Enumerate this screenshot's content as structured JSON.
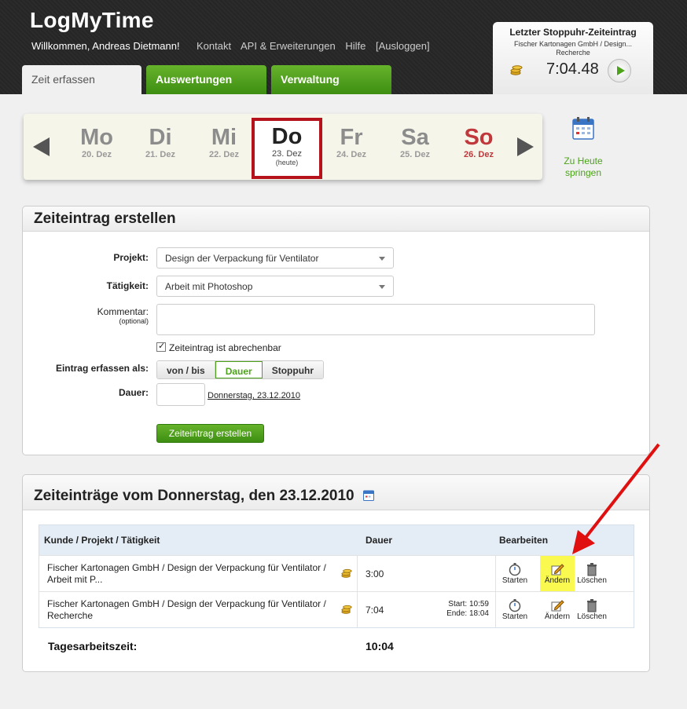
{
  "header": {
    "logo": "LogMyTime",
    "welcome": "Willkommen, Andreas Dietmann!",
    "links": [
      "Kontakt",
      "API & Erweiterungen",
      "Hilfe",
      "[Ausloggen]"
    ],
    "tabs": [
      "Zeit erfassen",
      "Auswertungen",
      "Verwaltung"
    ]
  },
  "stopwatch": {
    "title": "Letzter Stoppuhr-Zeiteintrag",
    "subtitle_1": "Fischer Kartonagen GmbH / Design...",
    "subtitle_2": "Recherche",
    "time": "7:04.48"
  },
  "days": [
    {
      "name": "Mo",
      "date": "20. Dez"
    },
    {
      "name": "Di",
      "date": "21. Dez"
    },
    {
      "name": "Mi",
      "date": "22. Dez"
    },
    {
      "name": "Do",
      "date": "23. Dez",
      "sub": "(heute)"
    },
    {
      "name": "Fr",
      "date": "24. Dez"
    },
    {
      "name": "Sa",
      "date": "25. Dez"
    },
    {
      "name": "So",
      "date": "26. Dez"
    }
  ],
  "today_link": "Zu Heute springen",
  "form": {
    "title": "Zeiteintrag erstellen",
    "projekt_label": "Projekt:",
    "projekt_value": "Design der Verpackung für Ventilator",
    "taetigkeit_label": "Tätigkeit:",
    "taetigkeit_value": "Arbeit mit Photoshop",
    "kommentar_label": "Kommentar:",
    "kommentar_hint": "(optional)",
    "billable_label": "Zeiteintrag ist abrechenbar",
    "mode_label": "Eintrag erfassen als:",
    "modes": [
      "von / bis",
      "Dauer",
      "Stoppuhr"
    ],
    "dauer_label": "Dauer:",
    "date_link": "Donnerstag, 23.12.2010",
    "submit": "Zeiteintrag erstellen"
  },
  "entries": {
    "title": "Zeiteinträge vom Donnerstag, den 23.12.2010",
    "columns": [
      "Kunde / Projekt / Tätigkeit",
      "Dauer",
      "Bearbeiten"
    ],
    "rows": [
      {
        "text": "Fischer Kartonagen GmbH / Design der Verpackung für Ventilator / Arbeit mit P...",
        "duration": "3:00",
        "start": "",
        "end": ""
      },
      {
        "text": "Fischer Kartonagen GmbH / Design der Verpackung für Ventilator / Recherche",
        "duration": "7:04",
        "start": "Start: 10:59",
        "end": "Ende: 18:04"
      }
    ],
    "actions": [
      "Starten",
      "Ändern",
      "Löschen"
    ],
    "total_label": "Tagesarbeitszeit:",
    "total_value": "10:04"
  },
  "colors": {
    "accent_green": "#4ca31a",
    "today_red": "#b5121b",
    "sunday_red": "#c0383b",
    "highlight": "#f9f950"
  }
}
